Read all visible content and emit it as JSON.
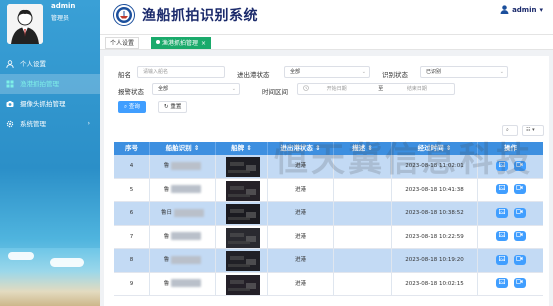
{
  "sidebar": {
    "user_name": "admin",
    "user_role": "管理员",
    "items": [
      {
        "label": "个人设置",
        "icon": "user-icon",
        "active": false
      },
      {
        "label": "渔港抓拍管理",
        "icon": "grid-icon",
        "active": true
      },
      {
        "label": "摄像头抓拍管理",
        "icon": "camera-icon",
        "active": false
      },
      {
        "label": "系统管理",
        "icon": "gear-icon",
        "active": false,
        "arrow": "›"
      }
    ]
  },
  "header": {
    "title": "渔船抓拍识别系统",
    "user": "admin",
    "user_arrow": "▾"
  },
  "tabs": [
    {
      "label": "个人设置",
      "active": false
    },
    {
      "label": "渔港抓拍管理",
      "active": true,
      "close": "×"
    }
  ],
  "filters": {
    "ship_name_label": "船名",
    "ship_name_placeholder": "请输入船名",
    "port_status_label": "进出港状态",
    "port_status_value": "全部",
    "recog_status_label": "识别状态",
    "recog_status_value": "已识别",
    "alarm_status_label": "报警状态",
    "alarm_status_value": "全部",
    "time_range_label": "时间区间",
    "start_placeholder": "开始日期",
    "range_sep": "至",
    "end_placeholder": "结束日期",
    "search_button": "查询",
    "reset_button": "重置",
    "select_arrow": "⌄"
  },
  "toolbar": {
    "search_icon": "⌕",
    "columns_icon": "☷"
  },
  "watermark": "恒天冀信息科技",
  "table": {
    "headers": [
      "序号",
      "船舶识别",
      "船牌",
      "进出港状态",
      "描述",
      "经过时间",
      "操作"
    ],
    "rows": [
      {
        "index": "4",
        "ship": "鲁",
        "status": "进港",
        "desc": "",
        "time": "2023-08-18 11:02:01"
      },
      {
        "index": "5",
        "ship": "鲁",
        "status": "进港",
        "desc": "",
        "time": "2023-08-18 10:41:38"
      },
      {
        "index": "6",
        "ship": "鲁日",
        "status": "进港",
        "desc": "",
        "time": "2023-08-18 10:38:52"
      },
      {
        "index": "7",
        "ship": "鲁",
        "status": "进港",
        "desc": "",
        "time": "2023-08-18 10:22:59"
      },
      {
        "index": "8",
        "ship": "鲁",
        "status": "进港",
        "desc": "",
        "time": "2023-08-18 10:19:20"
      },
      {
        "index": "9",
        "ship": "鲁",
        "status": "进港",
        "desc": "",
        "time": "2023-08-18 10:02:15"
      }
    ]
  }
}
